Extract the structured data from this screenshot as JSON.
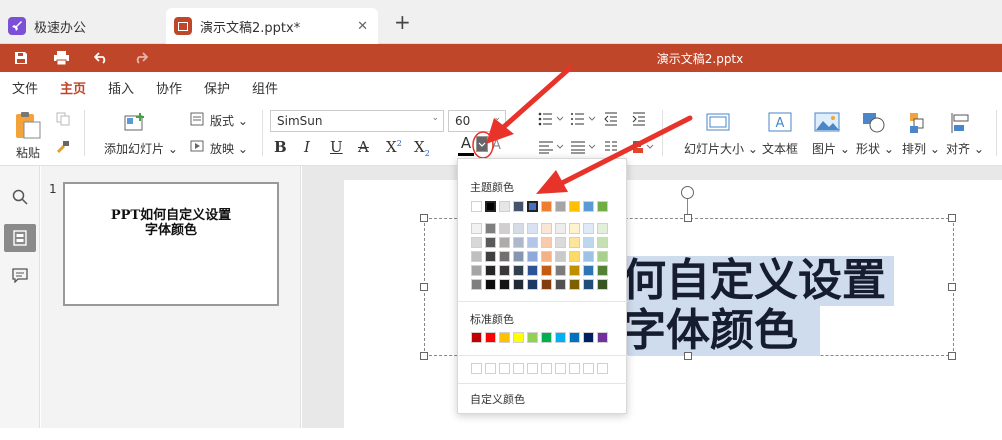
{
  "tabs": [
    {
      "label": "极速办公"
    },
    {
      "label": "演示文稿2.pptx*"
    }
  ],
  "title": "演示文稿2.pptx",
  "menu": [
    "文件",
    "主页",
    "插入",
    "协作",
    "保护",
    "组件"
  ],
  "ribbon": {
    "paste": "粘贴",
    "add_slide": "添加幻灯片",
    "layout": "版式",
    "play": "放映",
    "font_name": "SimSun",
    "font_size": "60",
    "slide_size": "幻灯片大小",
    "textbox": "文本框",
    "image": "图片",
    "shape": "形状",
    "arrange": "排列",
    "align": "对齐"
  },
  "format": {
    "bold": "B",
    "italic": "I",
    "underline": "U",
    "strike": "A",
    "superscript": "X",
    "subscript": "X",
    "sup": "2",
    "sub": "2",
    "font_color": "A",
    "highlight": "A"
  },
  "thumbnail": {
    "number": "1",
    "line1": "PPT如何自定义设置",
    "line2": "字体颜色"
  },
  "slide": {
    "line1": "何自定义设置",
    "line2": "字体颜色"
  },
  "color_popup": {
    "theme_label": "主题颜色",
    "standard_label": "标准颜色",
    "custom_label": "自定义颜色",
    "theme_top": [
      "#ffffff",
      "#000000",
      "#e7e6e6",
      "#44546a",
      "#4472c4",
      "#ed7d31",
      "#a5a5a5",
      "#ffc000",
      "#5b9bd5",
      "#70ad47"
    ],
    "theme_shades": [
      [
        "#f2f2f2",
        "#7f7f7f",
        "#d0cece",
        "#d6dce4",
        "#d9e2f3",
        "#fbe5d5",
        "#ededed",
        "#fff2cc",
        "#deebf6",
        "#e2efd9"
      ],
      [
        "#d8d8d8",
        "#595959",
        "#aeabab",
        "#adb9ca",
        "#b4c6e7",
        "#f7cbac",
        "#dbdbdb",
        "#fee599",
        "#bdd7ee",
        "#c5e0b3"
      ],
      [
        "#bfbfbf",
        "#3f3f3f",
        "#757070",
        "#8496b0",
        "#8eaadb",
        "#f4b183",
        "#c9c9c9",
        "#ffd965",
        "#9cc3e5",
        "#a8d08d"
      ],
      [
        "#a5a5a5",
        "#262626",
        "#3a3838",
        "#323f4f",
        "#2f5496",
        "#c55a11",
        "#7b7b7b",
        "#bf8f00",
        "#2e75b5",
        "#538135"
      ],
      [
        "#7f7f7f",
        "#0c0c0c",
        "#171616",
        "#222a35",
        "#1e3864",
        "#833c0b",
        "#525252",
        "#7f6000",
        "#1e4e79",
        "#375623"
      ]
    ],
    "standard": [
      "#c00000",
      "#ff0000",
      "#ffc000",
      "#ffff00",
      "#92d050",
      "#00b050",
      "#00b0f0",
      "#0070c0",
      "#002060",
      "#7030a0"
    ],
    "recent": [
      "#ffffff",
      "#ffffff",
      "#ffffff",
      "#ffffff",
      "#ffffff",
      "#ffffff",
      "#ffffff",
      "#ffffff",
      "#ffffff",
      "#ffffff"
    ]
  },
  "colors": {
    "accent": "#c0462a",
    "highlight": "#cfdcee",
    "arrow": "#e8332a"
  }
}
